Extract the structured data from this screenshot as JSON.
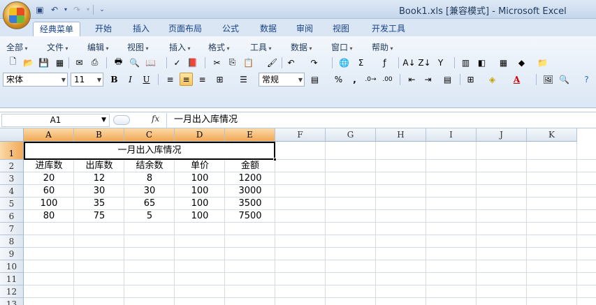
{
  "window": {
    "title": "Book1.xls  [兼容模式] - Microsoft Excel"
  },
  "ribbon_tabs": [
    "经典菜单",
    "开始",
    "插入",
    "页面布局",
    "公式",
    "数据",
    "审阅",
    "视图",
    "开发工具"
  ],
  "menus": [
    "全部",
    "文件",
    "编辑",
    "视图",
    "插入",
    "格式",
    "工具",
    "数据",
    "窗口",
    "帮助"
  ],
  "toolbar": {
    "font_name": "宋体",
    "font_size": "11",
    "bold": "B",
    "italic": "I",
    "underline": "U",
    "number_format": "常规",
    "percent": "%",
    "comma": ","
  },
  "formula_bar": {
    "name_box": "A1",
    "fx": "fx",
    "content": "一月出入库情况"
  },
  "columns": [
    "A",
    "B",
    "C",
    "D",
    "E",
    "F",
    "G",
    "H",
    "I",
    "J",
    "K"
  ],
  "rows": [
    "1",
    "2",
    "3",
    "4",
    "5",
    "6",
    "7",
    "8",
    "9",
    "10",
    "11",
    "12",
    "13"
  ],
  "sheet": {
    "title_cell": "一月出入库情况",
    "headers": [
      "进库数",
      "出库数",
      "结余数",
      "单价",
      "金额"
    ],
    "data": [
      [
        "20",
        "12",
        "8",
        "100",
        "1200"
      ],
      [
        "60",
        "30",
        "30",
        "100",
        "3000"
      ],
      [
        "100",
        "35",
        "65",
        "100",
        "3500"
      ],
      [
        "80",
        "75",
        "5",
        "100",
        "7500"
      ]
    ]
  },
  "colors": {
    "accent": "#f1a955",
    "ribbon_bg": "#dbe7f5",
    "tab_text": "#15428b"
  }
}
